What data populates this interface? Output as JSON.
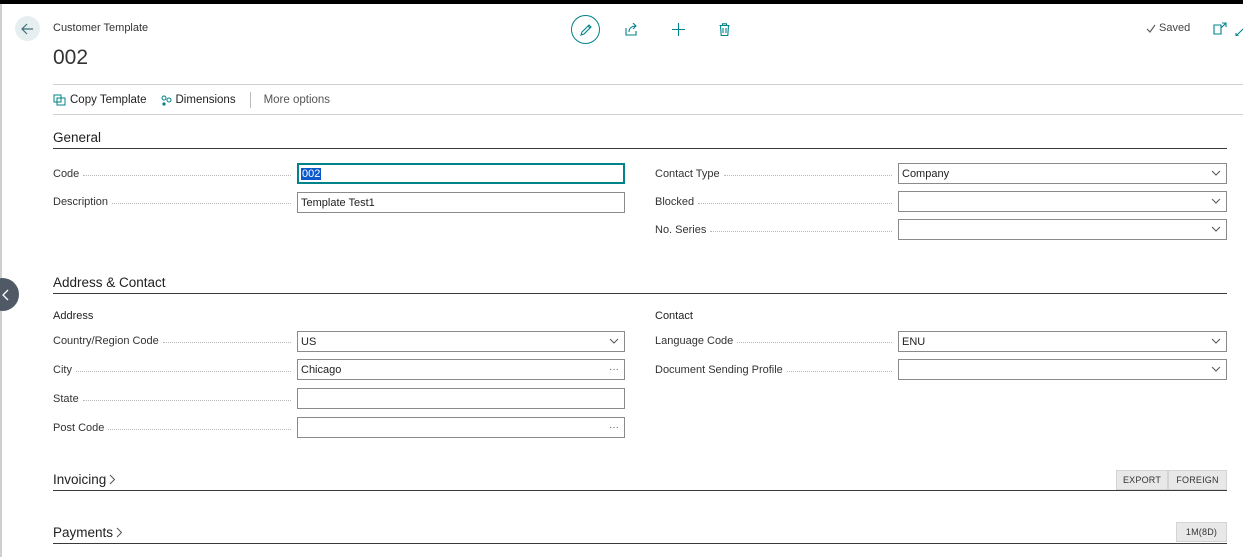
{
  "header": {
    "breadcrumb": "Customer Template",
    "title": "002",
    "saved_label": "Saved"
  },
  "toolbar": {
    "copy_template": "Copy Template",
    "dimensions": "Dimensions",
    "more_options": "More options"
  },
  "general": {
    "title": "General",
    "code": {
      "label": "Code",
      "value": "002"
    },
    "description": {
      "label": "Description",
      "value": "Template Test1"
    },
    "contact_type": {
      "label": "Contact Type",
      "value": "Company"
    },
    "blocked": {
      "label": "Blocked",
      "value": ""
    },
    "no_series": {
      "label": "No. Series",
      "value": ""
    }
  },
  "address_contact": {
    "title": "Address & Contact",
    "address_heading": "Address",
    "contact_heading": "Contact",
    "country": {
      "label": "Country/Region Code",
      "value": "US"
    },
    "city": {
      "label": "City",
      "value": "Chicago"
    },
    "state": {
      "label": "State",
      "value": ""
    },
    "post_code": {
      "label": "Post Code",
      "value": ""
    },
    "language": {
      "label": "Language Code",
      "value": "ENU"
    },
    "doc_sending": {
      "label": "Document Sending Profile",
      "value": ""
    }
  },
  "invoicing": {
    "title": "Invoicing",
    "badges": [
      "EXPORT",
      "FOREIGN"
    ]
  },
  "payments": {
    "title": "Payments",
    "badges": [
      "1M(8D)"
    ]
  },
  "glyphs": {
    "ellipsis": "···"
  },
  "colors": {
    "accent": "#00838a",
    "selection": "#0a58ca",
    "side_button": "#505a66"
  }
}
